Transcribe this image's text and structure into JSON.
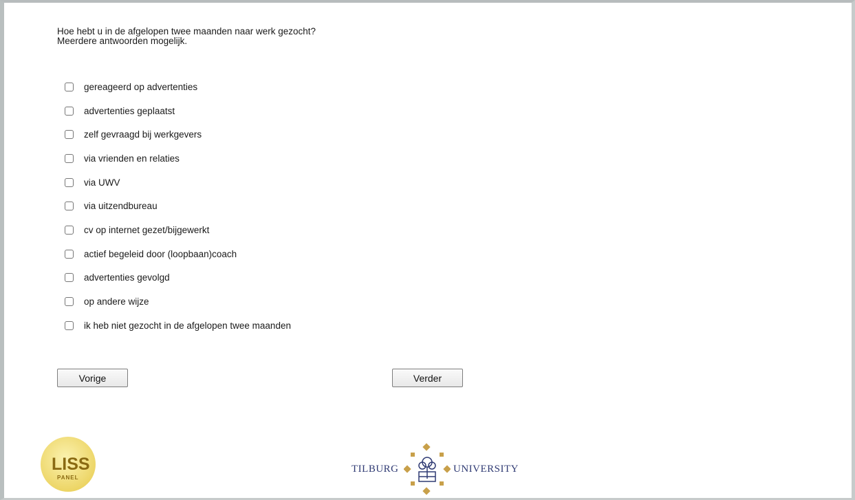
{
  "question": {
    "line1": "Hoe hebt u in de afgelopen twee maanden naar werk gezocht?",
    "line2": "Meerdere antwoorden mogelijk."
  },
  "options": [
    "gereageerd op advertenties",
    "advertenties geplaatst",
    "zelf gevraagd bij werkgevers",
    "via vrienden en relaties",
    "via UWV",
    "via uitzendbureau",
    "cv op internet gezet/bijgewerkt",
    "actief begeleid door (loopbaan)coach",
    "advertenties gevolgd",
    "op andere wijze",
    "ik heb niet gezocht in de afgelopen twee maanden"
  ],
  "buttons": {
    "prev": "Vorige",
    "next": "Verder"
  },
  "logos": {
    "liss": {
      "main": "LISS",
      "sub": "PANEL"
    },
    "tilburg": {
      "left": "TILBURG",
      "right": "UNIVERSITY"
    }
  },
  "colors": {
    "liss_yellow": "#f3e27a",
    "liss_text": "#8a6a12",
    "tilburg_blue": "#2f3a73",
    "tilburg_gold": "#c8a04a"
  }
}
